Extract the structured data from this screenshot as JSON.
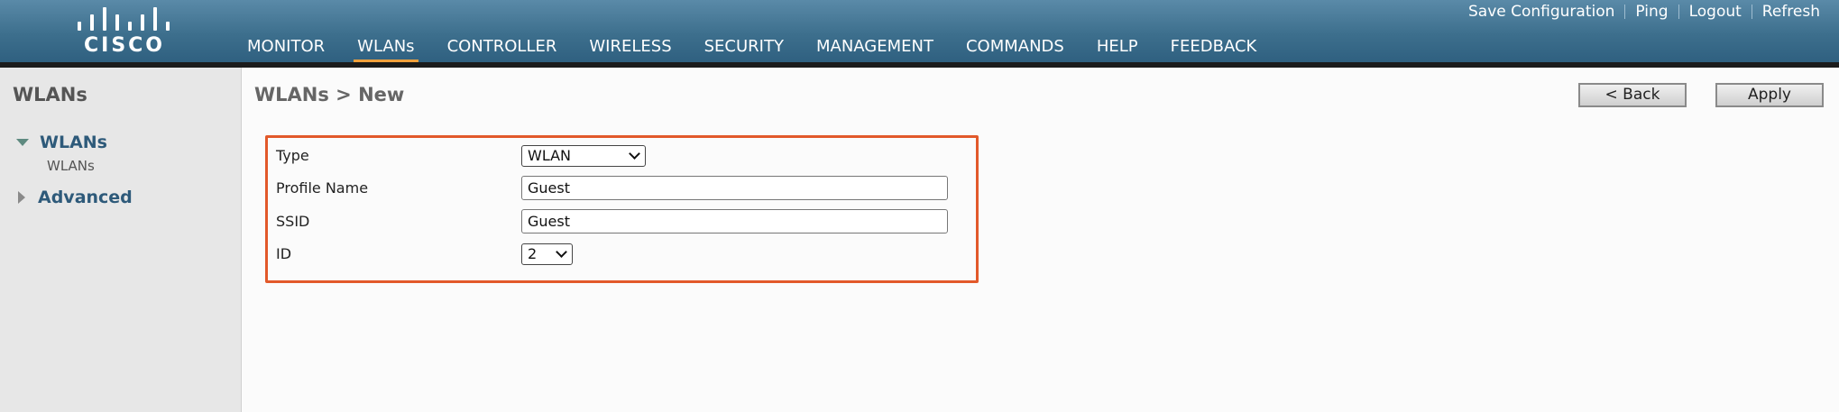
{
  "header": {
    "logo_text": "CISCO",
    "top_links": [
      {
        "label": "Save Configuration"
      },
      {
        "label": "Ping"
      },
      {
        "label": "Logout"
      },
      {
        "label": "Refresh"
      }
    ],
    "nav": [
      {
        "label": "MONITOR",
        "active": false
      },
      {
        "label": "WLANs",
        "active": true
      },
      {
        "label": "CONTROLLER",
        "active": false
      },
      {
        "label": "WIRELESS",
        "active": false
      },
      {
        "label": "SECURITY",
        "active": false
      },
      {
        "label": "MANAGEMENT",
        "active": false
      },
      {
        "label": "COMMANDS",
        "active": false
      },
      {
        "label": "HELP",
        "active": false
      },
      {
        "label": "FEEDBACK",
        "active": false
      }
    ]
  },
  "sidebar": {
    "title": "WLANs",
    "items": [
      {
        "label": "WLANs",
        "expanded": true,
        "icon": "triangle-down-icon",
        "children": [
          {
            "label": "WLANs"
          }
        ]
      },
      {
        "label": "Advanced",
        "expanded": false,
        "icon": "triangle-right-icon"
      }
    ]
  },
  "main": {
    "title": "WLANs > New",
    "buttons": {
      "back": "< Back",
      "apply": "Apply"
    },
    "form": {
      "type": {
        "label": "Type",
        "value": "WLAN"
      },
      "profile_name": {
        "label": "Profile Name",
        "value": "Guest"
      },
      "ssid": {
        "label": "SSID",
        "value": "Guest"
      },
      "id": {
        "label": "ID",
        "value": "2"
      }
    }
  },
  "colors": {
    "header": "#3d6f8d",
    "active_tab": "#f0a03c",
    "highlight_box": "#e2592a",
    "sidebar_link": "#2e5a7a"
  }
}
